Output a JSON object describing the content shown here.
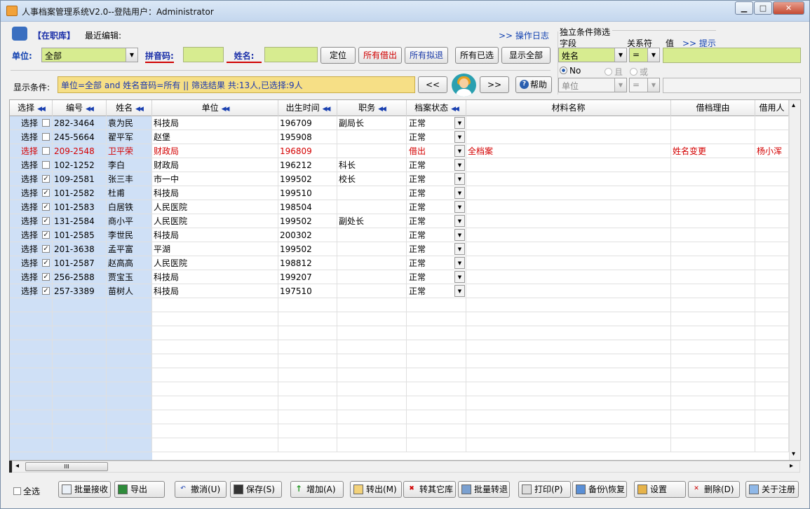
{
  "window": {
    "title": "人事档案管理系统V2.0--登陆用户：Administrator",
    "min": "▁",
    "max": "□",
    "close": "✕"
  },
  "top": {
    "status_tag": "【在职库】",
    "recent_label": "最近编辑:",
    "op_log": ">> 操作日志",
    "unit_label": "单位:",
    "unit_value": "全部",
    "pinyin_label": "拼音码:",
    "name_label": "姓名:",
    "btn_locate": "定位",
    "btn_all_borrowed": "所有借出",
    "btn_all_retire": "所有拟退",
    "btn_all_selected": "所有已选",
    "btn_show_all": "显示全部",
    "cond_label": "显示条件:",
    "cond_text": "单位=全部 and 姓名音码=所有 || 筛选结果 共:13人,已选择:9人",
    "btn_prev": "<<",
    "btn_next": ">>",
    "btn_help": "帮助",
    "help_icon": "?"
  },
  "filter": {
    "title": "独立条件筛选",
    "field_label": "字段",
    "rel_label": "关系符",
    "value_label": "值",
    "hint": ">> 提示",
    "field1": "姓名",
    "rel1": "=",
    "radio_no": "No",
    "radio_and": "且",
    "radio_or": "或",
    "field2": "单位",
    "rel2": "="
  },
  "grid": {
    "headers": [
      "选择",
      "编号",
      "姓名",
      "单位",
      "出生时间",
      "职务",
      "档案状态",
      "材料名称",
      "借档理由",
      "借用人"
    ],
    "sort_glyph": "◀◀",
    "dropdown_glyph": "▼",
    "rows": [
      {
        "sel": "选择",
        "checked": "",
        "id": "282-3464",
        "name": "袁为民",
        "unit": "科技局",
        "birth": "196709",
        "title": "副局长",
        "status": "正常",
        "material": "",
        "reason": "",
        "borrower": ""
      },
      {
        "sel": "选择",
        "checked": "",
        "id": "245-5664",
        "name": "翟平军",
        "unit": "赵堡",
        "birth": "195908",
        "title": "",
        "status": "正常",
        "material": "",
        "reason": "",
        "borrower": ""
      },
      {
        "sel": "选择",
        "checked": "",
        "id": "209-2548",
        "name": "卫平荣",
        "unit": "财政局",
        "birth": "196809",
        "title": "",
        "status": "借出",
        "material": "全档案",
        "reason": "姓名变更",
        "borrower": "杨小浑",
        "red": true
      },
      {
        "sel": "选择",
        "checked": "",
        "id": "102-1252",
        "name": "李白",
        "unit": "财政局",
        "birth": "196212",
        "title": "科长",
        "status": "正常",
        "material": "",
        "reason": "",
        "borrower": ""
      },
      {
        "sel": "选择",
        "checked": "✓",
        "id": "109-2581",
        "name": "张三丰",
        "unit": "市一中",
        "birth": "199502",
        "title": "校长",
        "status": "正常",
        "material": "",
        "reason": "",
        "borrower": ""
      },
      {
        "sel": "选择",
        "checked": "✓",
        "id": "101-2582",
        "name": "杜甫",
        "unit": "科技局",
        "birth": "199510",
        "title": "",
        "status": "正常",
        "material": "",
        "reason": "",
        "borrower": ""
      },
      {
        "sel": "选择",
        "checked": "✓",
        "id": "101-2583",
        "name": "白居铁",
        "unit": "人民医院",
        "birth": "198504",
        "title": "",
        "status": "正常",
        "material": "",
        "reason": "",
        "borrower": ""
      },
      {
        "sel": "选择",
        "checked": "✓",
        "id": "131-2584",
        "name": "商小平",
        "unit": "人民医院",
        "birth": "199502",
        "title": "副处长",
        "status": "正常",
        "material": "",
        "reason": "",
        "borrower": ""
      },
      {
        "sel": "选择",
        "checked": "✓",
        "id": "101-2585",
        "name": "李世民",
        "unit": "科技局",
        "birth": "200302",
        "title": "",
        "status": "正常",
        "material": "",
        "reason": "",
        "borrower": ""
      },
      {
        "sel": "选择",
        "checked": "✓",
        "id": "201-3638",
        "name": "孟平富",
        "unit": "平湖",
        "birth": "199502",
        "title": "",
        "status": "正常",
        "material": "",
        "reason": "",
        "borrower": ""
      },
      {
        "sel": "选择",
        "checked": "✓",
        "id": "101-2587",
        "name": "赵高高",
        "unit": "人民医院",
        "birth": "198812",
        "title": "",
        "status": "正常",
        "material": "",
        "reason": "",
        "borrower": ""
      },
      {
        "sel": "选择",
        "checked": "✓",
        "id": "256-2588",
        "name": "贾宝玉",
        "unit": "科技局",
        "birth": "199207",
        "title": "",
        "status": "正常",
        "material": "",
        "reason": "",
        "borrower": ""
      },
      {
        "sel": "选择",
        "checked": "✓",
        "id": "257-3389",
        "name": "苗树人",
        "unit": "科技局",
        "birth": "197510",
        "title": "",
        "status": "正常",
        "material": "",
        "reason": "",
        "borrower": ""
      }
    ],
    "hscroll_grip": "III",
    "hscroll_left": "◂",
    "hscroll_right": "▸",
    "vscroll_up": "▴",
    "vscroll_down": "▾"
  },
  "bottom": {
    "select_all": "全选",
    "batch_receive": "批量接收",
    "export": "导出",
    "undo": "撤消(U)",
    "save": "保存(S)",
    "add": "增加(A)",
    "transfer_out": "转出(M)",
    "transfer_other": "转其它库",
    "batch_retire": "批量转退",
    "print": "打印(P)",
    "backup": "备份\\恢复",
    "settings": "设置",
    "delete": "删除(D)",
    "about": "关于注册"
  },
  "colors": {
    "accent_green": "#d7ec90",
    "condition_bg": "#f6df86",
    "left_col_bg": "#cfe0f6",
    "borrowed_red": "#d40000"
  }
}
